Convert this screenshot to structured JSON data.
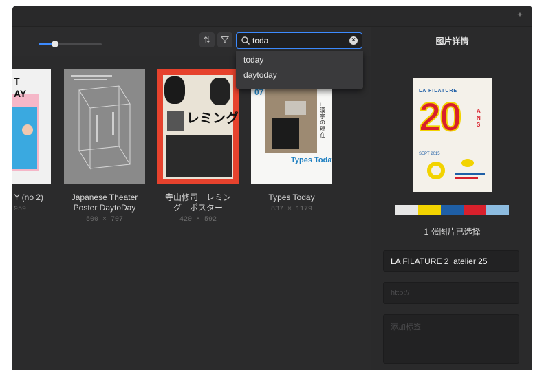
{
  "window": {
    "pin_icon": "pin-icon"
  },
  "toolbar": {
    "zoom_level": 0.26,
    "sort_icon": "sort-icon",
    "filter_icon": "filter-icon",
    "search": {
      "value": "toda",
      "icon": "search-icon",
      "clear_icon": "clear-icon"
    }
  },
  "suggestions": [
    {
      "label": "today"
    },
    {
      "label": "daytoday"
    }
  ],
  "items": [
    {
      "title_lines": [
        "Y (no 2)"
      ],
      "dims": "959"
    },
    {
      "title_lines": [
        "Japanese Theater",
        "Poster DaytoDay"
      ],
      "dims": "500 × 707"
    },
    {
      "title_lines": [
        "寺山修司　レミン",
        "グ　ポスター"
      ],
      "dims": "420 × 592"
    },
    {
      "title_lines": [
        "Types Today"
      ],
      "dims": "837 × 1179"
    }
  ],
  "thumb_text": {
    "partial_poster": "T\nAY",
    "red_poster_katakana": "レミング",
    "types_issue": "07",
    "types_caption": "Types Today",
    "types_side": "i 漢字の現在",
    "preview_label": "LA FILATURE",
    "preview_number": "20",
    "preview_side": "ANS",
    "preview_date": "SEPT 2015"
  },
  "details_panel": {
    "title": "图片详情",
    "selection_text": "1 张图片已选择",
    "name_value": "LA FILATURE 2  atelier 25",
    "url_placeholder": "http://",
    "tags_placeholder": "添加标签",
    "palette": [
      "#e6e6e6",
      "#f2d300",
      "#1f5fa6",
      "#d8202c",
      "#8dbce0"
    ]
  }
}
